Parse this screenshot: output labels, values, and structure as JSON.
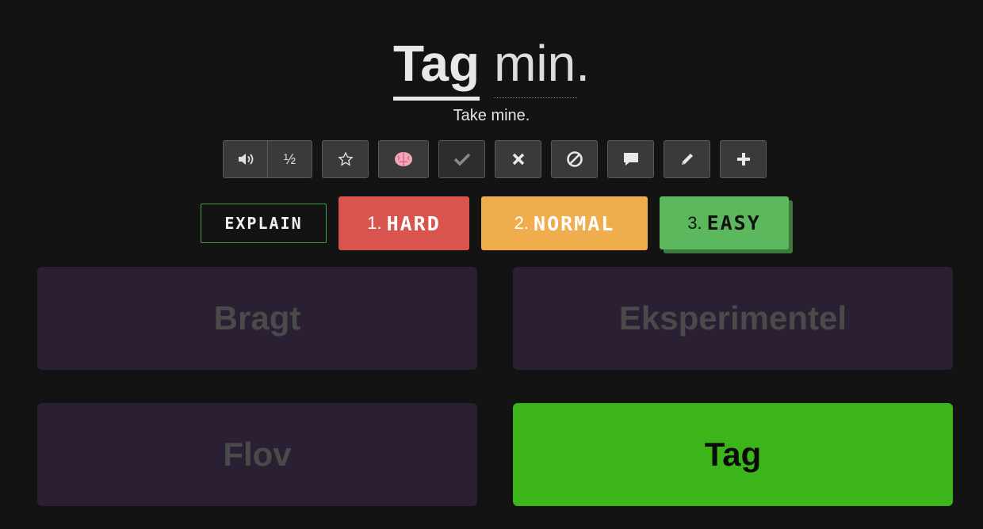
{
  "sentence": {
    "target_word": "Tag",
    "rest": "min.",
    "translation": "Take mine."
  },
  "toolbar": {
    "speed_label": "½",
    "icons": [
      "speaker-icon",
      "star-icon",
      "brain-icon",
      "check-icon",
      "x-icon",
      "ban-icon",
      "comment-icon",
      "pencil-icon",
      "plus-icon"
    ]
  },
  "actions": {
    "explain": "EXPLAIN",
    "hard_num": "1.",
    "hard": "HARD",
    "normal_num": "2.",
    "normal": "NORMAL",
    "easy_num": "3.",
    "easy": "EASY"
  },
  "choices": [
    {
      "label": "Bragt",
      "state": "disabled"
    },
    {
      "label": "Eksperimentel",
      "state": "disabled"
    },
    {
      "label": "Flov",
      "state": "disabled"
    },
    {
      "label": "Tag",
      "state": "correct"
    }
  ],
  "colors": {
    "background": "#131313",
    "hard": "#d9534f",
    "normal": "#f0ad4e",
    "easy": "#5cb85c",
    "correct": "#3cb51a",
    "choice_disabled": "#2b1f33"
  }
}
